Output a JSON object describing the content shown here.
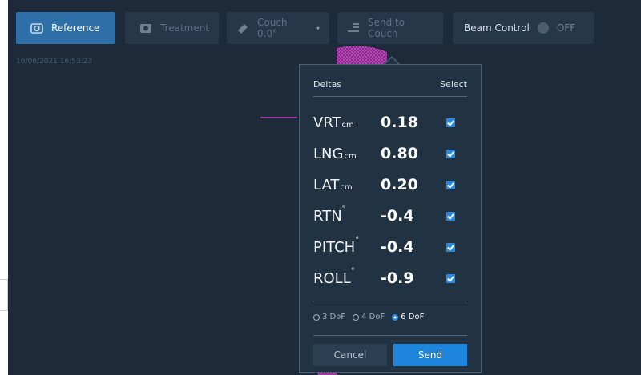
{
  "toolbar": {
    "reference_label": "Reference",
    "treatment_label": "Treatment",
    "couch_label": "Couch 0.0°",
    "send_to_couch_label": "Send to Couch",
    "beam_control_label": "Beam Control",
    "beam_state": "OFF"
  },
  "timestamp": "16/08/2021 16:53:23",
  "deltas_panel": {
    "title": "Deltas",
    "select_label": "Select",
    "rows": [
      {
        "name": "VRT",
        "unit": "cm",
        "value": "0.18",
        "checked": true
      },
      {
        "name": "LNG",
        "unit": "cm",
        "value": "0.80",
        "checked": true
      },
      {
        "name": "LAT",
        "unit": "cm",
        "value": "0.20",
        "checked": true
      },
      {
        "name": "RTN",
        "unit": "°",
        "value": "-0.4",
        "checked": true
      },
      {
        "name": "PITCH",
        "unit": "°",
        "value": "-0.4",
        "checked": true
      },
      {
        "name": "ROLL",
        "unit": "°",
        "value": "-0.9",
        "checked": true
      }
    ],
    "dof_options": [
      "3 DoF",
      "4 DoF",
      "6 DoF"
    ],
    "dof_selected": "6 DoF",
    "cancel_label": "Cancel",
    "send_label": "Send"
  },
  "colors": {
    "background": "#1c2a3a",
    "accent_blue": "#1f86de",
    "model_magenta": "#c83cc8",
    "model_green": "#2fb82f"
  }
}
